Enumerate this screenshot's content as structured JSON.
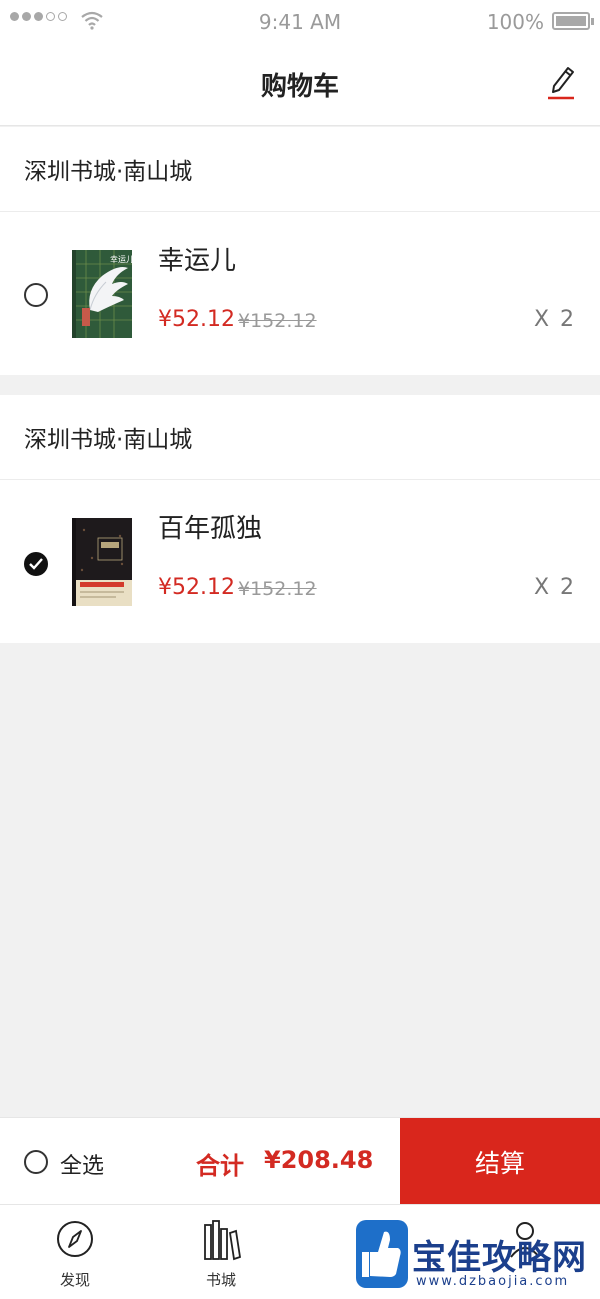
{
  "status_bar": {
    "time": "9:41 AM",
    "battery": "100%"
  },
  "nav": {
    "title": "购物车",
    "edit_icon": "pencil-icon"
  },
  "shops": [
    {
      "name": "深圳书城·南山城",
      "item": {
        "title": "幸运儿",
        "price": "¥52.12",
        "original_price": "¥152.12",
        "quantity": "X 2",
        "checked": false
      }
    },
    {
      "name": "深圳书城·南山城",
      "item": {
        "title": "百年孤独",
        "price": "¥52.12",
        "original_price": "¥152.12",
        "quantity": "X 2",
        "checked": true
      }
    }
  ],
  "footer": {
    "select_all": "全选",
    "total_label": "合计",
    "total_value": "¥208.48",
    "checkout": "结算"
  },
  "tabs": [
    {
      "label": "发现",
      "icon": "compass-icon"
    },
    {
      "label": "书城",
      "icon": "bookshelf-icon"
    },
    {
      "label": "",
      "icon": "cart-icon"
    },
    {
      "label": "",
      "icon": "profile-icon"
    }
  ],
  "watermark": {
    "text": "宝佳攻略网",
    "url": "www.dzbaojia.com"
  },
  "colors": {
    "accent": "#d9261c",
    "price": "#d32a22",
    "background": "#f1f1f1"
  }
}
